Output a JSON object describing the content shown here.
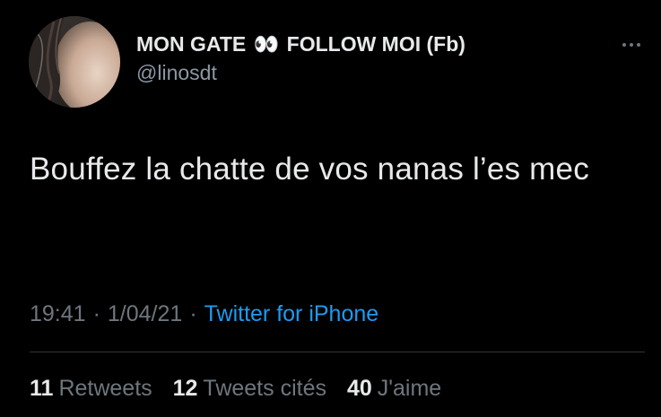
{
  "author": {
    "display_name_part1": "MON GATE",
    "display_name_emoji": "👀",
    "display_name_part2": "FOLLOW MOI (Fb)",
    "handle": "@linosdt",
    "avatar_icon": "profile-photo"
  },
  "tweet": {
    "text": "Bouffez la chatte de vos nanas l’es mec",
    "time": "19:41",
    "date": "1/04/21",
    "separator": "·",
    "source": "Twitter for iPhone"
  },
  "stats": {
    "retweets_count": "11",
    "retweets_label": "Retweets",
    "quotes_count": "12",
    "quotes_label": "Tweets cités",
    "likes_count": "40",
    "likes_label": "J'aime"
  },
  "colors": {
    "background": "#000000",
    "primary_text": "#e7e9ea",
    "secondary_text": "#6e767d",
    "link": "#1d9bf0",
    "divider": "#2f3336"
  },
  "icons": {
    "more": "more-horizontal-icon"
  }
}
